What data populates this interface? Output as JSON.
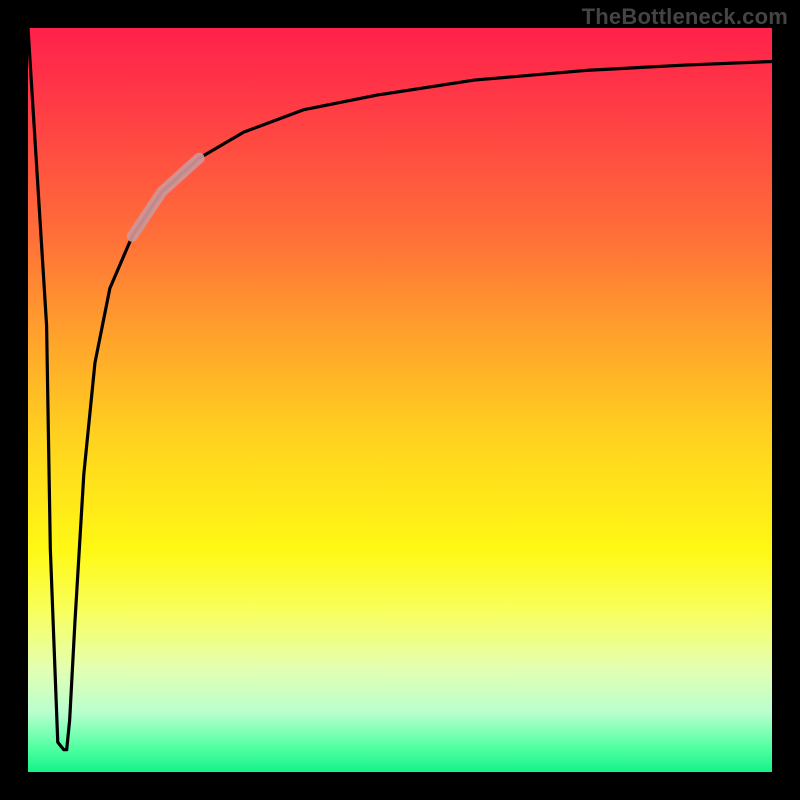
{
  "watermark": "TheBottleneck.com",
  "chart_data": {
    "type": "line",
    "title": "",
    "xlabel": "",
    "ylabel": "",
    "xlim": [
      0,
      100
    ],
    "ylim": [
      0,
      100
    ],
    "series": [
      {
        "name": "curve",
        "x": [
          0.0,
          2.5,
          3.0,
          4.0,
          4.8,
          5.2,
          5.6,
          6.3,
          7.5,
          9.0,
          11.0,
          14.0,
          18.0,
          23.0,
          29.0,
          37.0,
          47.0,
          60.0,
          75.0,
          88.0,
          100.0
        ],
        "y": [
          100,
          60,
          30,
          4,
          3,
          3,
          7,
          20,
          40,
          55,
          65,
          72,
          78,
          82.5,
          86,
          89,
          91,
          93,
          94.3,
          95,
          95.5
        ]
      }
    ],
    "highlight": {
      "name": "highlight-segment",
      "x": [
        14.0,
        18.0,
        23.0
      ],
      "y": [
        72,
        78,
        82.5
      ]
    },
    "gradient_stops": [
      {
        "pos": 0.0,
        "color": "#ff214b"
      },
      {
        "pos": 0.1,
        "color": "#ff3a46"
      },
      {
        "pos": 0.28,
        "color": "#ff6f38"
      },
      {
        "pos": 0.4,
        "color": "#ff9d2d"
      },
      {
        "pos": 0.55,
        "color": "#ffd21f"
      },
      {
        "pos": 0.7,
        "color": "#fff814"
      },
      {
        "pos": 0.78,
        "color": "#f9ff59"
      },
      {
        "pos": 0.86,
        "color": "#e4ffb0"
      },
      {
        "pos": 0.92,
        "color": "#b8ffcf"
      },
      {
        "pos": 0.97,
        "color": "#4bff9f"
      },
      {
        "pos": 1.0,
        "color": "#17f18b"
      }
    ]
  }
}
